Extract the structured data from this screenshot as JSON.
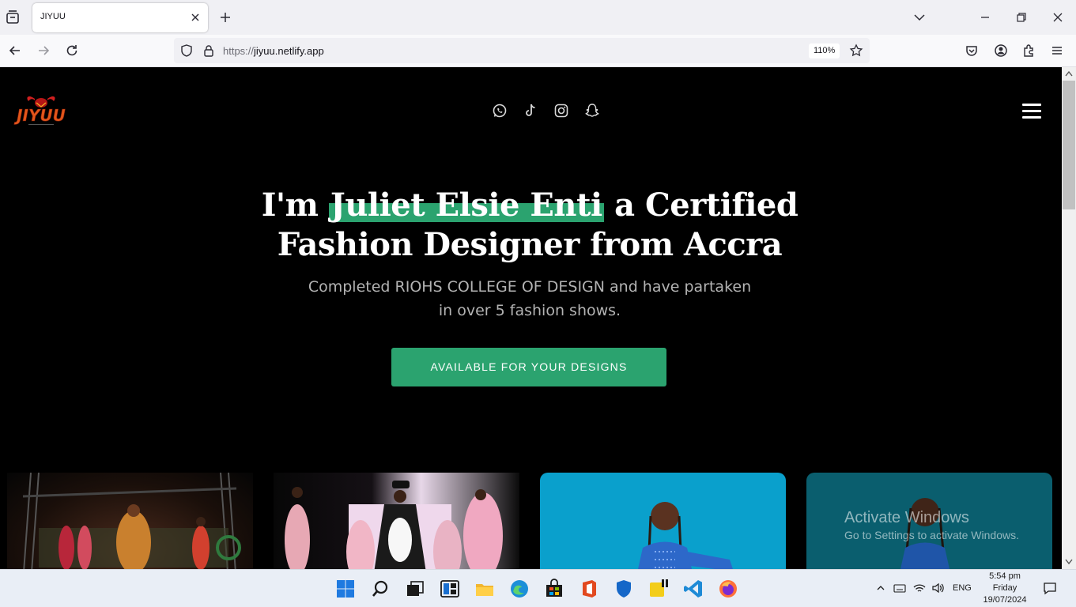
{
  "browser": {
    "tab_title": "JIYUU",
    "url_scheme": "https://",
    "url_host": "jiyuu.netlify.app",
    "zoom": "110%"
  },
  "page": {
    "brand": "JIYUU",
    "socials": [
      "whatsapp-icon",
      "tiktok-icon",
      "instagram-icon",
      "snapchat-icon"
    ],
    "hero": {
      "title_prefix": "I'm",
      "title_highlight": "Juliet Elsie Enti",
      "title_suffix_line1": "a Certified",
      "title_line2": "Fashion Designer from Accra",
      "subtitle": "Completed RIOHS COLLEGE OF DESIGN and have partaken in over 5 fashion shows.",
      "cta_label": "AVAILABLE FOR YOUR DESIGNS"
    },
    "accent_color": "#2ba36f"
  },
  "watermark": {
    "line1": "Activate Windows",
    "line2": "Go to Settings to activate Windows."
  },
  "taskbar": {
    "language": "ENG",
    "time": "5:54 pm",
    "day": "Friday",
    "date": "19/07/2024"
  }
}
